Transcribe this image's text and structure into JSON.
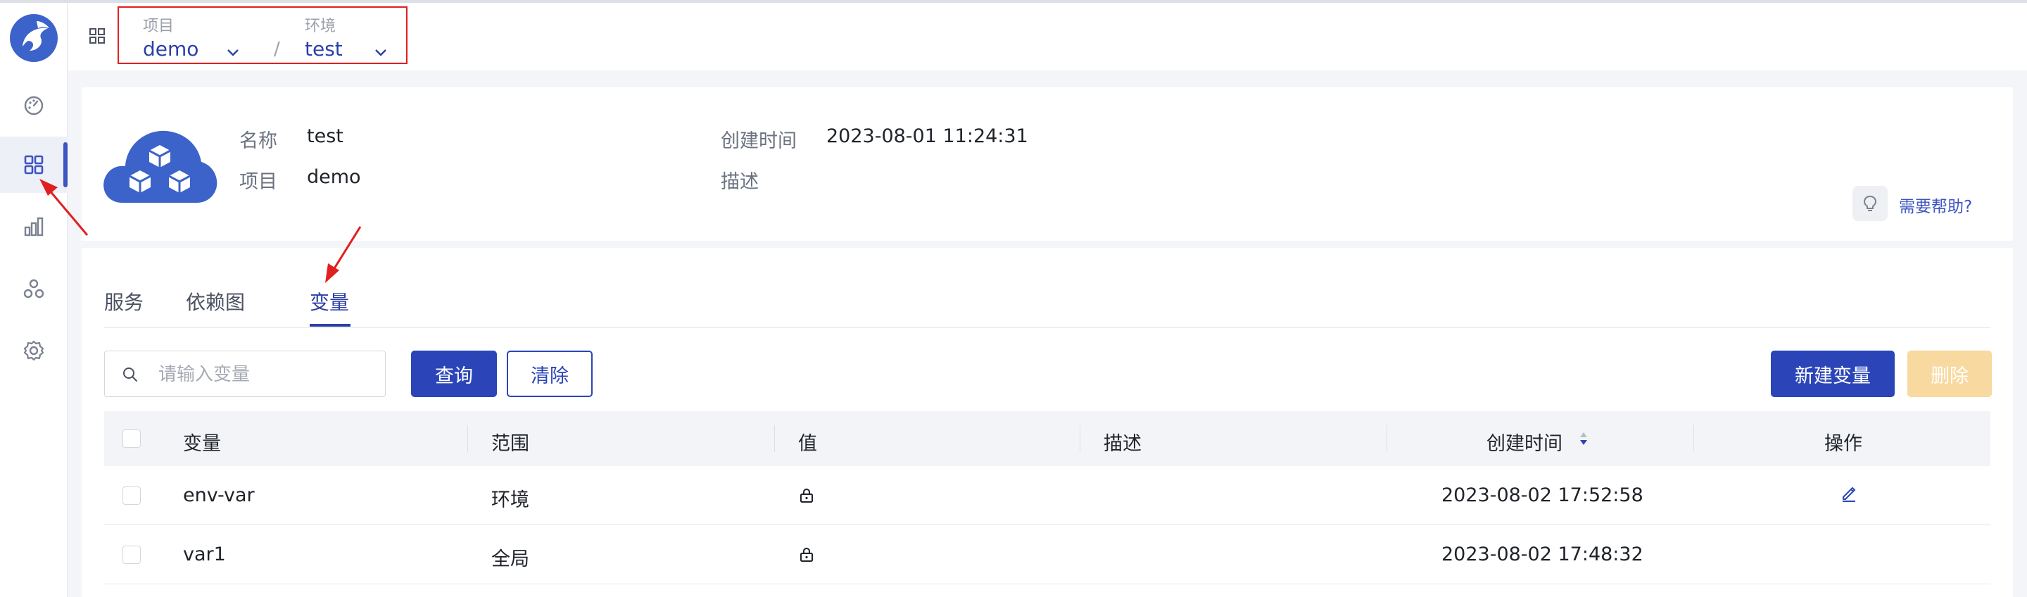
{
  "header": {
    "project_label": "项目",
    "project_value": "demo",
    "env_label": "环境",
    "env_value": "test",
    "separator": "/"
  },
  "sidebar": {
    "items": [
      {
        "name": "dashboard-icon"
      },
      {
        "name": "apps-grid-icon",
        "active": true
      },
      {
        "name": "bar-chart-icon"
      },
      {
        "name": "cluster-icon"
      },
      {
        "name": "gear-icon"
      }
    ]
  },
  "info": {
    "name_label": "名称",
    "name_value": "test",
    "project_label": "项目",
    "project_value": "demo",
    "created_label": "创建时间",
    "created_value": "2023-08-01 11:24:31",
    "desc_label": "描述",
    "desc_value": "",
    "help_text": "需要帮助?"
  },
  "tabs": [
    {
      "label": "服务"
    },
    {
      "label": "依赖图"
    },
    {
      "label": "变量",
      "active": true
    }
  ],
  "toolbar": {
    "search_placeholder": "请输入变量",
    "query_label": "查询",
    "clear_label": "清除",
    "new_label": "新建变量",
    "delete_label": "删除"
  },
  "table": {
    "columns": [
      "变量",
      "范围",
      "值",
      "描述",
      "创建时间",
      "操作"
    ],
    "rows": [
      {
        "variable": "env-var",
        "scope": "环境",
        "value": "locked",
        "description": "",
        "created": "2023-08-02 17:52:58",
        "editable": true
      },
      {
        "variable": "var1",
        "scope": "全局",
        "value": "locked",
        "description": "",
        "created": "2023-08-02 17:48:32",
        "editable": false
      }
    ]
  },
  "colors": {
    "accent": "#2b45b8",
    "annotation_red": "#e02020",
    "disabled_orange": "#f8d9a0"
  }
}
